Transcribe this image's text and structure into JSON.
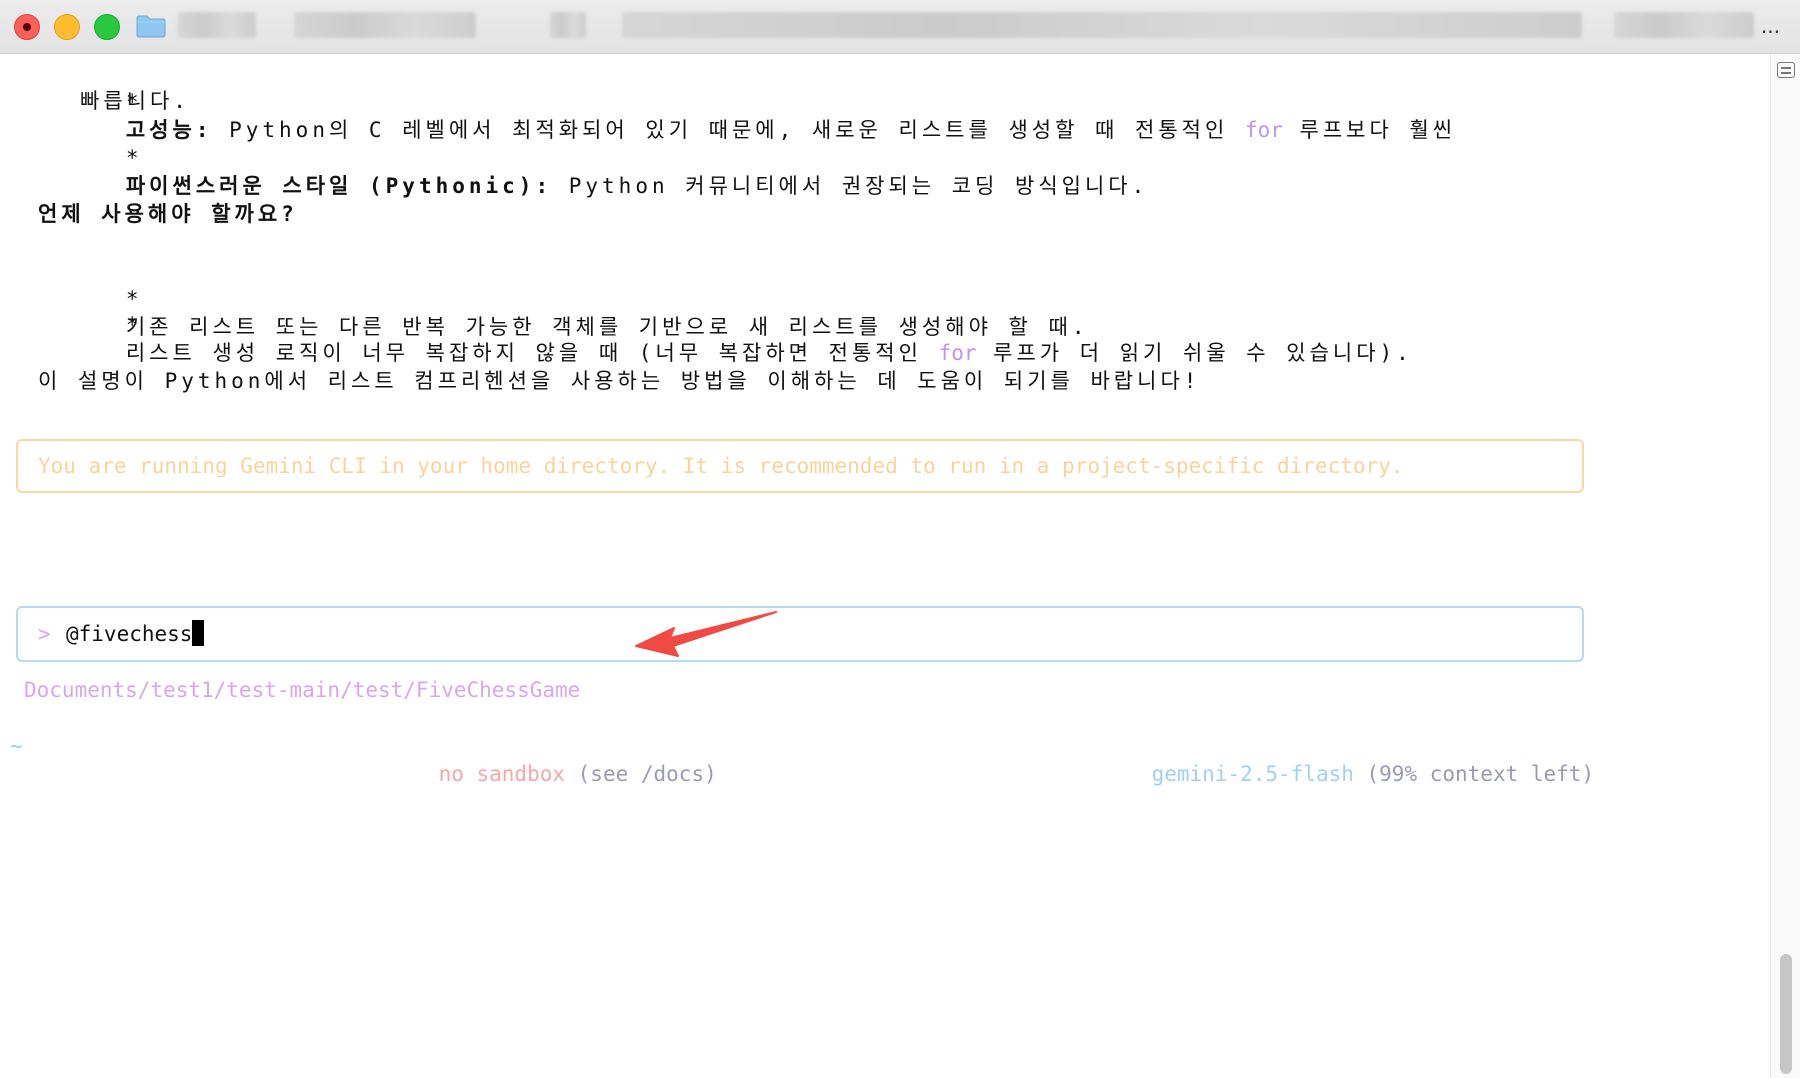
{
  "window": {
    "icons": {
      "close": "close-traffic-light",
      "minimize": "minimize-traffic-light",
      "maximize": "maximize-traffic-light",
      "folder": "folder-icon"
    },
    "title_ellipsis": "..."
  },
  "content": {
    "bullet1_label": "고성능:",
    "bullet1_text_a": " Python의 C 레벨에서 최적화되어 있기 때문에, 새로운 리스트를 생성할 때 전통적인 ",
    "bullet1_kw": "for",
    "bullet1_text_b": " 루프보다 훨씬",
    "bullet1_cont": "빠릅니다.",
    "bullet2_label": "파이썬스러운 스타일 (Pythonic):",
    "bullet2_text": " Python 커뮤니티에서 권장되는 코딩 방식입니다.",
    "section_heading": "언제 사용해야 할까요?",
    "when1": "기존 리스트 또는 다른 반복 가능한 객체를 기반으로 새 리스트를 생성해야 할 때.",
    "when2_a": "리스트 생성 로직이 너무 복잡하지 않을 때 (너무 복잡하면 전통적인 ",
    "when2_kw": "for",
    "when2_b": " 루프가 더 읽기 쉬울 수 있습니다).",
    "closing": "이 설명이 Python에서 리스트 컴프리헨션을 사용하는 방법을 이해하는 데 도움이 되기를 바랍니다!",
    "bullet_char": "*"
  },
  "warning": {
    "text": "You are running Gemini CLI in your home directory. It is recommended to run in a project-specific directory."
  },
  "input": {
    "prompt": ">",
    "value": "@fivechess"
  },
  "suggestion": {
    "path": "Documents/test1/test-main/test/FiveChessGame"
  },
  "status": {
    "cwd": "~",
    "sandbox": "no sandbox",
    "docs": " (see /docs)",
    "model": "gemini-2.5-flash",
    "context": " (99% context left)"
  },
  "colors": {
    "keyword": "#c792ea",
    "warning_border": "#fbd7a2",
    "input_border": "#b7daf5",
    "arrow": "#f04a45"
  }
}
